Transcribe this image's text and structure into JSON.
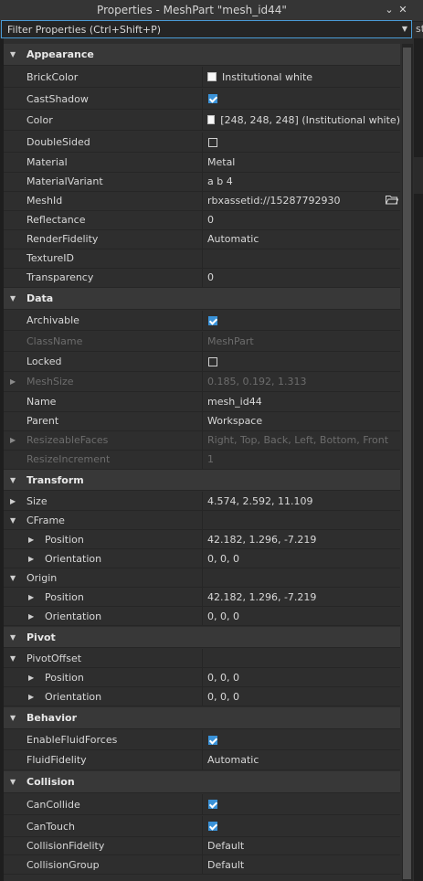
{
  "window": {
    "title": "Properties - MeshPart \"mesh_id44\"",
    "pin_glyph": "⌄",
    "close_glyph": "✕"
  },
  "filter": {
    "placeholder": "Filter Properties (Ctrl+Shift+P)",
    "value": "",
    "dropdown_glyph": "▼"
  },
  "edge_text": "st",
  "colors": {
    "background": "#2e2e2e",
    "category_bg": "#383838",
    "checkbox_on": "#3a92d8",
    "focus_border": "#4a9bd6"
  },
  "rows": [
    {
      "type": "category",
      "label": "Appearance",
      "expanded": true
    },
    {
      "type": "prop",
      "label": "BrickColor",
      "value": "Institutional white",
      "swatch": "#f8f8f8"
    },
    {
      "type": "prop",
      "label": "CastShadow",
      "checkbox": true
    },
    {
      "type": "prop",
      "label": "Color",
      "value": "[248, 248, 248] (Institutional white)",
      "swatch": "#f8f8f8"
    },
    {
      "type": "prop",
      "label": "DoubleSided",
      "checkbox": false
    },
    {
      "type": "prop",
      "label": "Material",
      "value": "Metal"
    },
    {
      "type": "prop",
      "label": "MaterialVariant",
      "value": "a b 4"
    },
    {
      "type": "prop",
      "label": "MeshId",
      "value": "rbxassetid://15287792930",
      "icon": "folder-icon"
    },
    {
      "type": "prop",
      "label": "Reflectance",
      "value": "0"
    },
    {
      "type": "prop",
      "label": "RenderFidelity",
      "value": "Automatic"
    },
    {
      "type": "prop",
      "label": "TextureID",
      "value": ""
    },
    {
      "type": "prop",
      "label": "Transparency",
      "value": "0"
    },
    {
      "type": "category",
      "label": "Data",
      "expanded": true
    },
    {
      "type": "prop",
      "label": "Archivable",
      "checkbox": true
    },
    {
      "type": "prop",
      "label": "ClassName",
      "value": "MeshPart",
      "disabled": true
    },
    {
      "type": "prop",
      "label": "Locked",
      "checkbox": false
    },
    {
      "type": "prop",
      "label": "MeshSize",
      "value": "0.185, 0.192, 1.313",
      "disabled": true,
      "expand": "closed"
    },
    {
      "type": "prop",
      "label": "Name",
      "value": "mesh_id44"
    },
    {
      "type": "prop",
      "label": "Parent",
      "value": "Workspace"
    },
    {
      "type": "prop",
      "label": "ResizeableFaces",
      "value": "Right, Top, Back, Left, Bottom, Front",
      "disabled": true,
      "expand": "closed"
    },
    {
      "type": "prop",
      "label": "ResizeIncrement",
      "value": "1",
      "disabled": true
    },
    {
      "type": "category",
      "label": "Transform",
      "expanded": true
    },
    {
      "type": "prop",
      "label": "Size",
      "value": "4.574, 2.592, 11.109",
      "expand": "closed"
    },
    {
      "type": "prop",
      "label": "CFrame",
      "value": "",
      "expand": "open"
    },
    {
      "type": "prop",
      "label": "Position",
      "value": "42.182, 1.296, -7.219",
      "expand": "closed",
      "indent": 1
    },
    {
      "type": "prop",
      "label": "Orientation",
      "value": "0, 0, 0",
      "expand": "closed",
      "indent": 1
    },
    {
      "type": "prop",
      "label": "Origin",
      "value": "",
      "expand": "open"
    },
    {
      "type": "prop",
      "label": "Position",
      "value": "42.182, 1.296, -7.219",
      "expand": "closed",
      "indent": 1
    },
    {
      "type": "prop",
      "label": "Orientation",
      "value": "0, 0, 0",
      "expand": "closed",
      "indent": 1
    },
    {
      "type": "category",
      "label": "Pivot",
      "expanded": true
    },
    {
      "type": "prop",
      "label": "PivotOffset",
      "value": "",
      "expand": "open"
    },
    {
      "type": "prop",
      "label": "Position",
      "value": "0, 0, 0",
      "expand": "closed",
      "indent": 1
    },
    {
      "type": "prop",
      "label": "Orientation",
      "value": "0, 0, 0",
      "expand": "closed",
      "indent": 1
    },
    {
      "type": "category",
      "label": "Behavior",
      "expanded": true
    },
    {
      "type": "prop",
      "label": "EnableFluidForces",
      "checkbox": true
    },
    {
      "type": "prop",
      "label": "FluidFidelity",
      "value": "Automatic"
    },
    {
      "type": "category",
      "label": "Collision",
      "expanded": true
    },
    {
      "type": "prop",
      "label": "CanCollide",
      "checkbox": true
    },
    {
      "type": "prop",
      "label": "CanTouch",
      "checkbox": true
    },
    {
      "type": "prop",
      "label": "CollisionFidelity",
      "value": "Default"
    },
    {
      "type": "prop",
      "label": "CollisionGroup",
      "value": "Default"
    }
  ]
}
